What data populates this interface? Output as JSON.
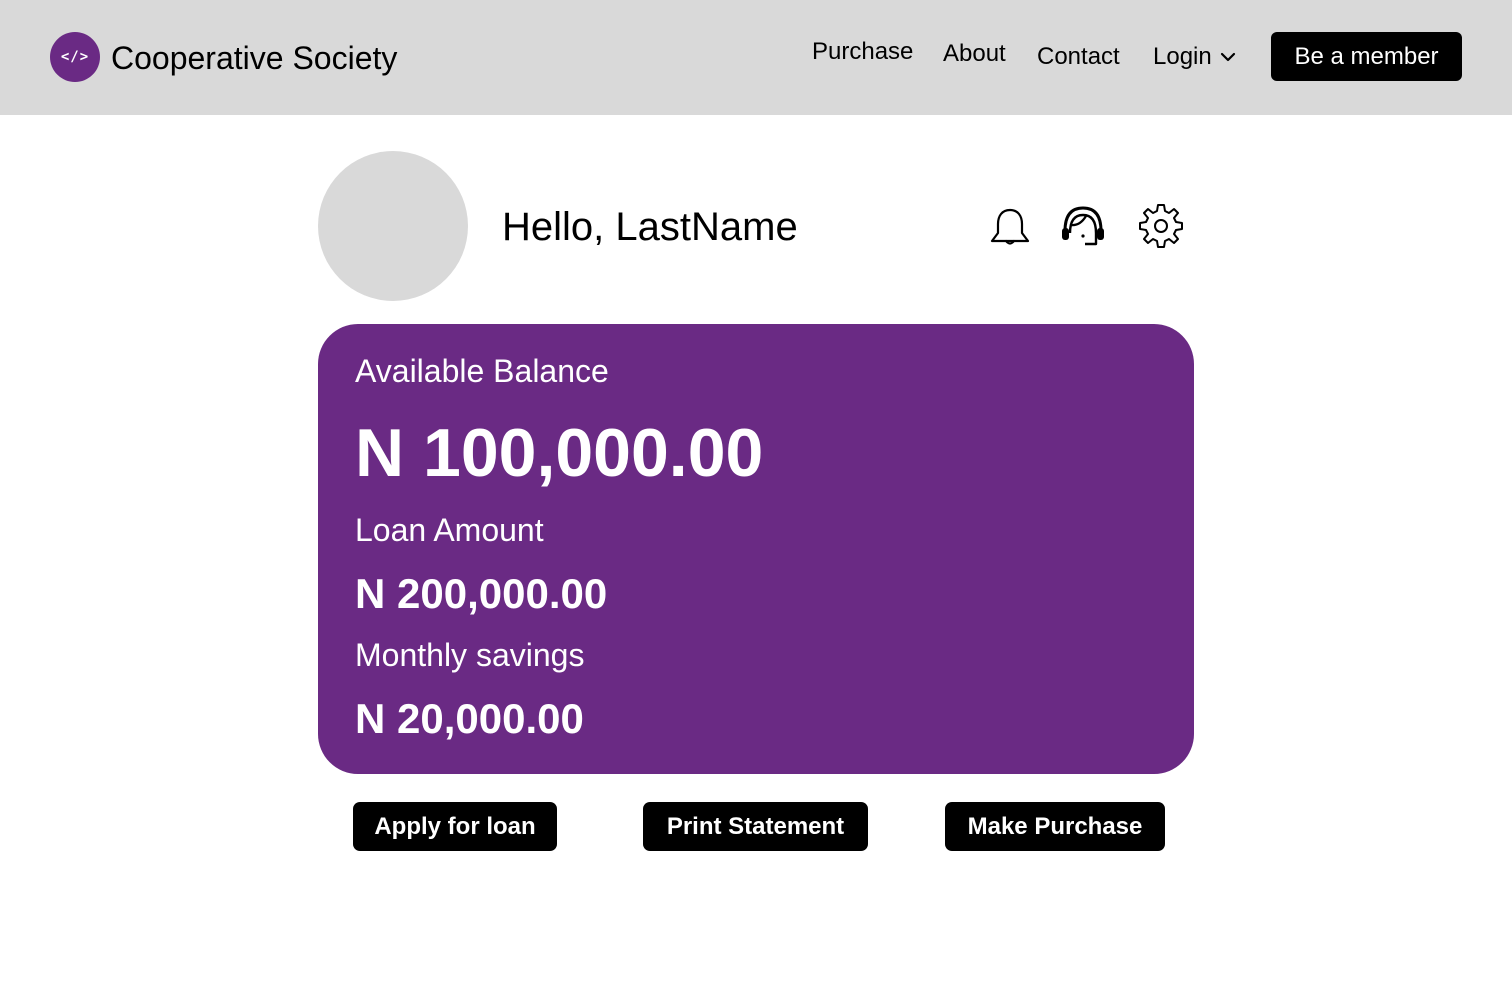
{
  "header": {
    "logo_text": "</>",
    "brand": "Cooperative Society",
    "nav": {
      "purchase": "Purchase",
      "about": "About",
      "contact": "Contact",
      "login": "Login"
    },
    "cta": "Be a member"
  },
  "profile": {
    "greeting": "Hello, LastName"
  },
  "icons": {
    "notifications": "bell-icon",
    "support": "support-agent-icon",
    "settings": "gear-icon"
  },
  "account": {
    "balance_label": "Available Balance",
    "balance_value": "N 100,000.00",
    "loan_label": "Loan Amount",
    "loan_value": "N 200,000.00",
    "savings_label": "Monthly savings",
    "savings_value": "N 20,000.00"
  },
  "actions": {
    "apply_loan": "Apply for loan",
    "print_statement": "Print Statement",
    "make_purchase": "Make Purchase"
  },
  "colors": {
    "brand_purple": "#6a2a84",
    "navbar_bg": "#d9d9d9",
    "button_bg": "#000000"
  }
}
